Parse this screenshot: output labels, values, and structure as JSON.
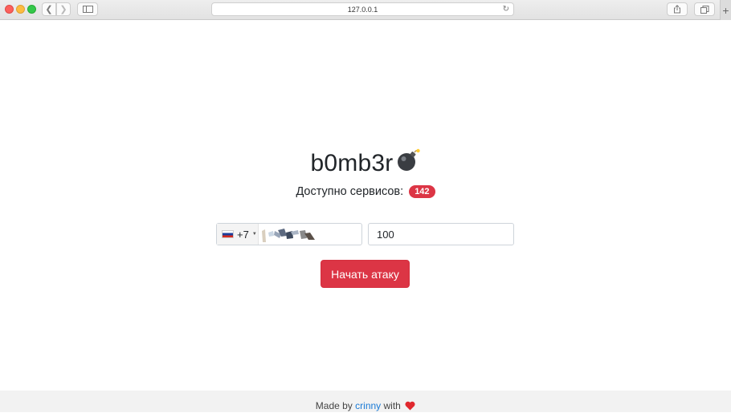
{
  "browser": {
    "url": "127.0.0.1"
  },
  "page": {
    "title": "b0mb3r",
    "services_label": "Доступно сервисов:",
    "services_count": "142",
    "phone": {
      "country_code": "+7",
      "country": "russia-flag"
    },
    "count_value": "100",
    "attack_button": "Начать атаку"
  },
  "footer": {
    "made_by": "Made by",
    "author": "crinny",
    "with": "with"
  },
  "colors": {
    "accent": "#dc3545",
    "link": "#1a7ad6"
  }
}
